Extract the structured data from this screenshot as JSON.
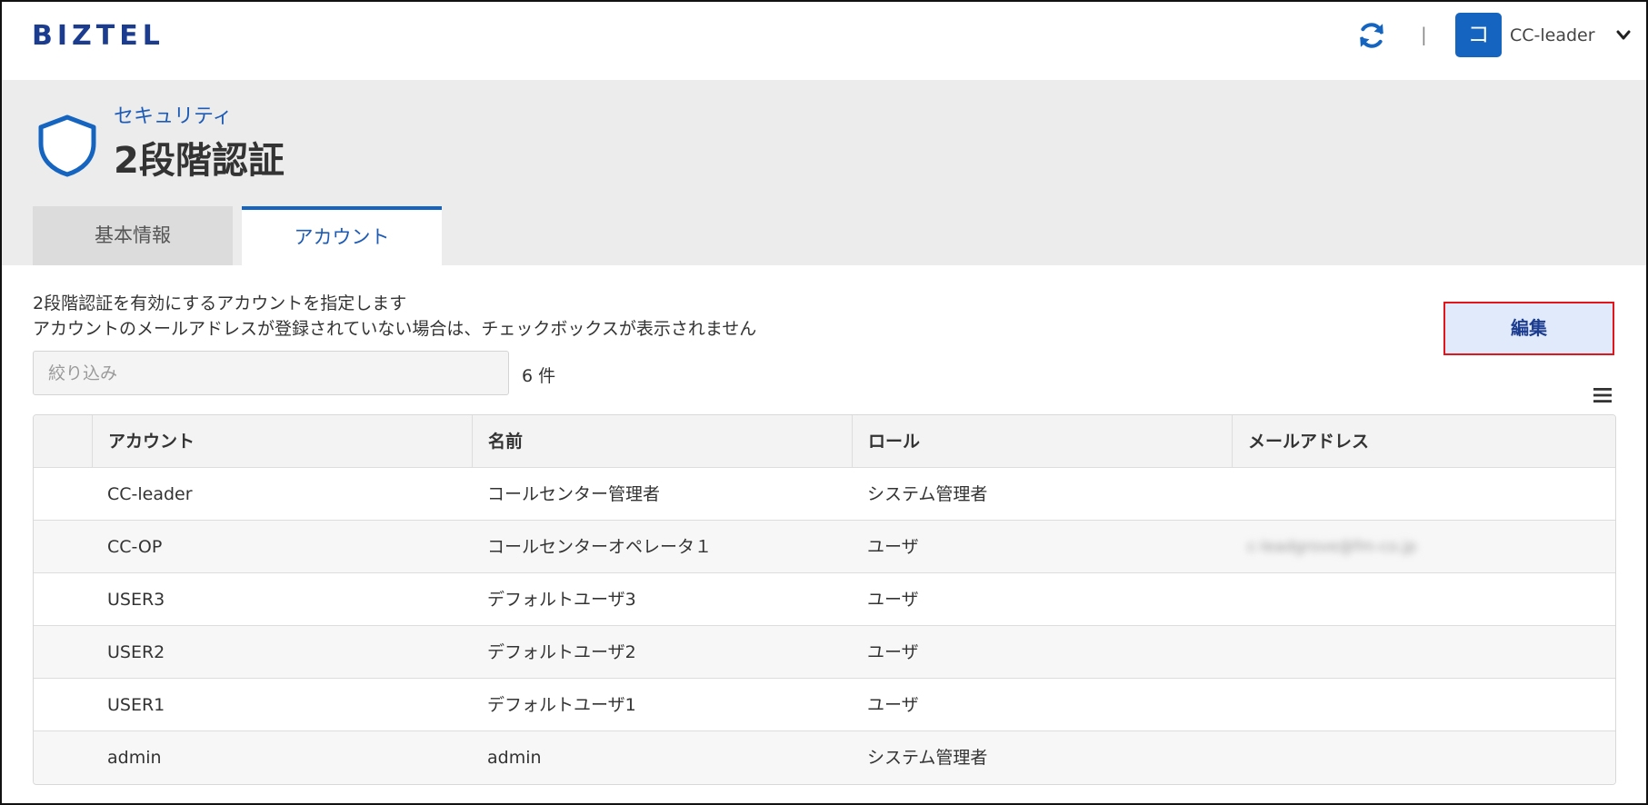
{
  "header": {
    "logo": "BIZTEL",
    "separator": "|",
    "avatar_letter": "コ",
    "user_name": "CC-leader",
    "icons": {
      "refresh": "refresh-icon",
      "user_menu": "chevron-down-icon"
    },
    "colors": {
      "brand": "#1b3c8f",
      "accent": "#1565c0"
    }
  },
  "page": {
    "category": "セキュリティ",
    "title": "2段階認証",
    "icon": "shield-icon"
  },
  "tabs": [
    {
      "label": "基本情報",
      "active": false
    },
    {
      "label": "アカウント",
      "active": true
    }
  ],
  "content": {
    "description_line1": "2段階認証を有効にするアカウントを指定します",
    "description_line2": "アカウントのメールアドレスが登録されていない場合は、チェックボックスが表示されません",
    "edit_label": "編集",
    "filter_placeholder": "絞り込み",
    "count_text": "6 件"
  },
  "table": {
    "columns": [
      "アカウント",
      "名前",
      "ロール",
      "メールアドレス"
    ],
    "rows": [
      {
        "account": "CC-leader",
        "name": "コールセンター管理者",
        "role": "システム管理者",
        "email": ""
      },
      {
        "account": "CC-OP",
        "name": "コールセンターオペレータ１",
        "role": "ユーザ",
        "email": "c-leadgrove@fm-co.jp"
      },
      {
        "account": "USER3",
        "name": "デフォルトユーザ3",
        "role": "ユーザ",
        "email": ""
      },
      {
        "account": "USER2",
        "name": "デフォルトユーザ2",
        "role": "ユーザ",
        "email": ""
      },
      {
        "account": "USER1",
        "name": "デフォルトユーザ1",
        "role": "ユーザ",
        "email": ""
      },
      {
        "account": "admin",
        "name": "admin",
        "role": "システム管理者",
        "email": ""
      }
    ]
  }
}
